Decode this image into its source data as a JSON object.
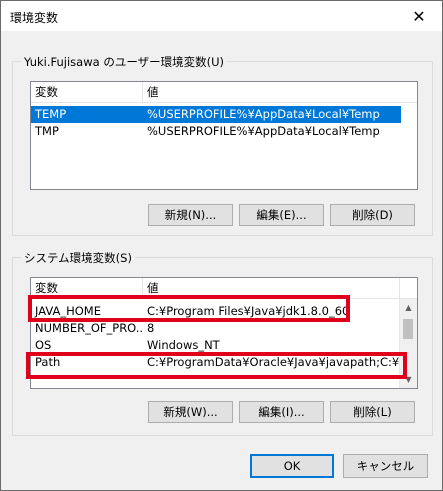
{
  "window": {
    "title": "環境変数",
    "close_glyph": "✕"
  },
  "user_vars": {
    "group_label": "Yuki.Fujisawa のユーザー環境変数(U)",
    "columns": [
      "変数",
      "値"
    ],
    "rows": [
      {
        "name": "TEMP",
        "value": "%USERPROFILE%¥AppData¥Local¥Temp",
        "selected": true
      },
      {
        "name": "TMP",
        "value": "%USERPROFILE%¥AppData¥Local¥Temp",
        "selected": false
      }
    ],
    "buttons": {
      "new": "新規(N)...",
      "edit": "編集(E)...",
      "delete": "削除(D)"
    }
  },
  "system_vars": {
    "group_label": "システム環境変数(S)",
    "columns": [
      "変数",
      "値"
    ],
    "rows": [
      {
        "name": "JAVA_HOME",
        "value": "C:¥Program Files¥Java¥jdk1.8.0_60",
        "highlighted": true
      },
      {
        "name": "NUMBER_OF_PRO...",
        "value": "8",
        "highlighted": false
      },
      {
        "name": "OS",
        "value": "Windows_NT",
        "highlighted": false
      },
      {
        "name": "Path",
        "value": "C:¥ProgramData¥Oracle¥Java¥javapath;C:¥Pr...",
        "highlighted": true
      }
    ],
    "buttons": {
      "new": "新規(W)...",
      "edit": "編集(I)...",
      "delete": "削除(L)"
    }
  },
  "footer": {
    "ok": "OK",
    "cancel": "キャンセル"
  },
  "colors": {
    "selection": "#0078d7",
    "highlight": "#e0001b"
  },
  "icons": {
    "close": "close-icon",
    "scroll_up": "scroll-up-arrow-icon",
    "scroll_down": "scroll-down-arrow-icon"
  }
}
